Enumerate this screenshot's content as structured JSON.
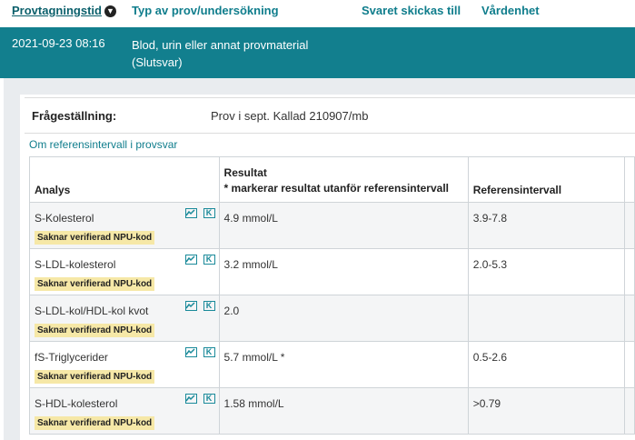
{
  "header": {
    "col_date": "Provtagningstid",
    "col_type": "Typ av prov/undersökning",
    "col_sent_to": "Svaret skickas till",
    "col_unit": "Vårdenhet"
  },
  "selected_row": {
    "date": "2021-09-23 08:16",
    "description": "Blod, urin eller annat provmaterial",
    "status": "(Slutsvar)"
  },
  "question": {
    "label": "Frågeställning:",
    "value": "Prov i sept. Kallad 210907/mb"
  },
  "reference_link": "Om referensintervall i provsvar",
  "table": {
    "headers": {
      "analys": "Analys",
      "result_line1": "Resultat",
      "result_line2": "* markerar resultat utanför referensintervall",
      "reference": "Referensintervall"
    },
    "rows": [
      {
        "name": "S-Kolesterol",
        "badge": "Saknar verifierad NPU-kod",
        "result": "4.9 mmol/L",
        "reference": "3.9-7.8"
      },
      {
        "name": "S-LDL-kolesterol",
        "badge": "Saknar verifierad NPU-kod",
        "result": "3.2 mmol/L",
        "reference": "2.0-5.3"
      },
      {
        "name": "S-LDL-kol/HDL-kol kvot",
        "badge": "Saknar verifierad NPU-kod",
        "result": "2.0",
        "reference": ""
      },
      {
        "name": "fS-Triglycerider",
        "badge": "Saknar verifierad NPU-kod",
        "result": "5.7 mmol/L *",
        "reference": "0.5-2.6"
      },
      {
        "name": "S-HDL-kolesterol",
        "badge": "Saknar verifierad NPU-kod",
        "result": "1.58 mmol/L",
        "reference": ">0.79"
      }
    ]
  },
  "icons": {
    "sort": "sort-down-icon",
    "chart": "chart-icon",
    "kodverk": "k-icon"
  },
  "colors": {
    "teal": "#127f8e",
    "link": "#0f7d8c",
    "badge": "#f6e8a7"
  }
}
